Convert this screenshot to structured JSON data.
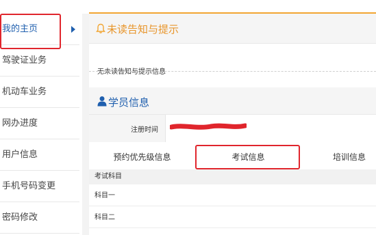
{
  "sidebar": {
    "items": [
      {
        "label": "我的主页",
        "active": true
      },
      {
        "label": "驾驶证业务"
      },
      {
        "label": "机动车业务"
      },
      {
        "label": "网办进度"
      },
      {
        "label": "用户信息"
      },
      {
        "label": "手机号码变更"
      },
      {
        "label": "密码修改"
      }
    ]
  },
  "notice": {
    "title": "未读告知与提示",
    "message": "无未读告知与提示信息"
  },
  "student": {
    "title": "学员信息",
    "reg_time_label": "注册时间"
  },
  "tabs": [
    {
      "label": "预约优先级信息"
    },
    {
      "label": "考试信息",
      "active": true
    },
    {
      "label": "培训信息"
    }
  ],
  "exam_table": {
    "header": "考试科目",
    "rows": [
      "科目一",
      "科目二"
    ]
  },
  "colors": {
    "accent": "#f2a531",
    "active_link": "#1f5fae",
    "annotation_red": "#e0252c"
  }
}
